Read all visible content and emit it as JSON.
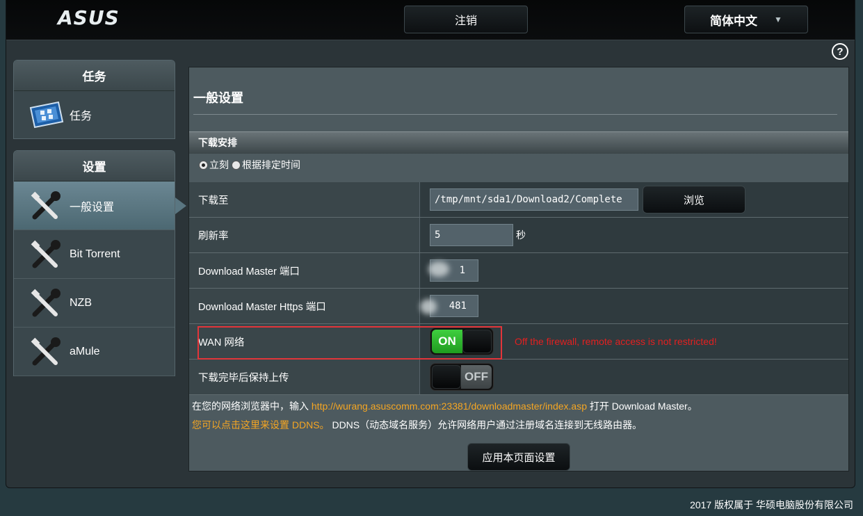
{
  "header": {
    "logo": "ASUS",
    "logout_label": "注销",
    "language_label": "简体中文",
    "caret": "▼",
    "help": "?"
  },
  "sidebar": {
    "task_section": {
      "title": "任务",
      "items": [
        {
          "label": "任务",
          "icon": "task-screen-icon"
        }
      ]
    },
    "settings_section": {
      "title": "设置",
      "items": [
        {
          "label": "一般设置",
          "icon": "tools-icon",
          "active": true
        },
        {
          "label": "Bit Torrent",
          "icon": "tools-icon"
        },
        {
          "label": "NZB",
          "icon": "tools-icon"
        },
        {
          "label": "aMule",
          "icon": "tools-icon"
        }
      ]
    }
  },
  "main": {
    "title": "一般设置",
    "section_title": "下载安排",
    "schedule_options": [
      {
        "label": "立刻",
        "checked": true
      },
      {
        "label": "根据排定时间",
        "checked": false
      }
    ],
    "rows": {
      "download_to": {
        "label": "下载至",
        "value": "/tmp/mnt/sda1/Download2/Complete",
        "browse": "浏览"
      },
      "refresh_rate": {
        "label": "刷新率",
        "value": "5",
        "unit": "秒"
      },
      "dm_port": {
        "label": "Download Master 端口",
        "value": "1"
      },
      "dm_https_port": {
        "label": "Download Master Https 端口",
        "value": "481"
      },
      "wan": {
        "label": "WAN 网络",
        "toggle": "ON",
        "warning": "Off the firewall, remote access is not restricted!"
      },
      "keep_upload": {
        "label": "下载完毕后保持上传",
        "toggle": "OFF"
      }
    },
    "info_line1": {
      "prefix": "在您的网络浏览器中，输入 ",
      "link": "http://wurang.asuscomm.com:23381/downloadmaster/index.asp",
      "suffix": " 打开 Download Master。"
    },
    "info_line2": {
      "link": "您可以点击这里来设置 DDNS。",
      "suffix": " DDNS（动态域名服务）允许网络用户通过注册域名连接到无线路由器。"
    },
    "apply_label": "应用本页面设置"
  },
  "footer": {
    "copyright": "2017 版权属于 华硕电脑股份有限公司"
  },
  "colors": {
    "accent_toggle_on": "#2eb82e",
    "warning": "#e32020",
    "link": "#f5a623",
    "highlight_box": "#e3353a"
  }
}
